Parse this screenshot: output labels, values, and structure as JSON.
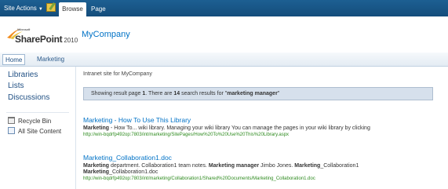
{
  "ribbon": {
    "site_actions": "Site Actions",
    "tabs": [
      "Browse",
      "Page"
    ]
  },
  "header": {
    "logo": {
      "microsoft": "Microsoft",
      "product": "SharePoint",
      "year": "2010"
    },
    "site_title": "MyCompany"
  },
  "topnav": {
    "items": [
      "Home",
      "Marketing"
    ]
  },
  "leftnav": {
    "items": [
      "Libraries",
      "Lists",
      "Discussions"
    ],
    "utilities": [
      {
        "label": "Recycle Bin",
        "icon": "recycle-bin-icon"
      },
      {
        "label": "All Site Content",
        "icon": "site-content-icon"
      }
    ]
  },
  "main": {
    "intro": "Intranet site for MyCompany",
    "results_summary": {
      "prefix": "Showing result page ",
      "page": "1",
      "middle": ". There are ",
      "count": "14",
      "suffix": " search results for \"",
      "query": "marketing manager",
      "end": "\""
    },
    "results": [
      {
        "title": "Marketing - How To Use This Library",
        "desc": [
          {
            "text": "Marketing",
            "bold": true
          },
          {
            "text": " - How To... wiki library. Managing your wiki library You can manage the pages in your wiki library by clicking",
            "bold": false
          }
        ],
        "url": "http://win-bqdrfp492op:7803/int/marketing/SitePages/How%20To%20Use%20This%20Library.aspx"
      },
      {
        "title": "Marketing_Collaboration1.doc",
        "desc": [
          {
            "text": "Marketing",
            "bold": true
          },
          {
            "text": " department. Collaboration1 team notes. ",
            "bold": false
          },
          {
            "text": "Marketing manager",
            "bold": true
          },
          {
            "text": " Jimbo Jones. ",
            "bold": false
          },
          {
            "text": "Marketing",
            "bold": true
          },
          {
            "text": "_Collaboration1",
            "bold": false
          }
        ],
        "desc2": [
          {
            "text": "Marketing",
            "bold": true
          },
          {
            "text": "_Collaboration1.doc",
            "bold": false
          }
        ],
        "url": "http://win-bqdrfp492op:7803/int/marketing/Collaboration1/Shared%20Documents/Marketing_Collaboration1.doc"
      }
    ]
  }
}
